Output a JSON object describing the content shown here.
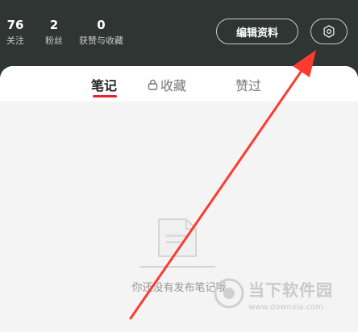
{
  "stats": [
    {
      "value": "76",
      "label": "关注"
    },
    {
      "value": "2",
      "label": "粉丝"
    },
    {
      "value": "0",
      "label": "获赞与收藏"
    }
  ],
  "header": {
    "edit_profile_label": "编辑资料",
    "settings_icon": "gear-icon"
  },
  "tabs": [
    {
      "label": "笔记",
      "active": true
    },
    {
      "label": "收藏",
      "icon": "lock-icon"
    },
    {
      "label": "赞过"
    }
  ],
  "empty_state": {
    "message": "你还没有发布笔记哦",
    "icon": "empty-note-icon"
  },
  "watermark": {
    "title": "当下软件园",
    "url": "www.downxia.com"
  },
  "colors": {
    "header_bg": "#2e3532",
    "accent": "#e3262e",
    "arrow": "#ff3b30"
  }
}
